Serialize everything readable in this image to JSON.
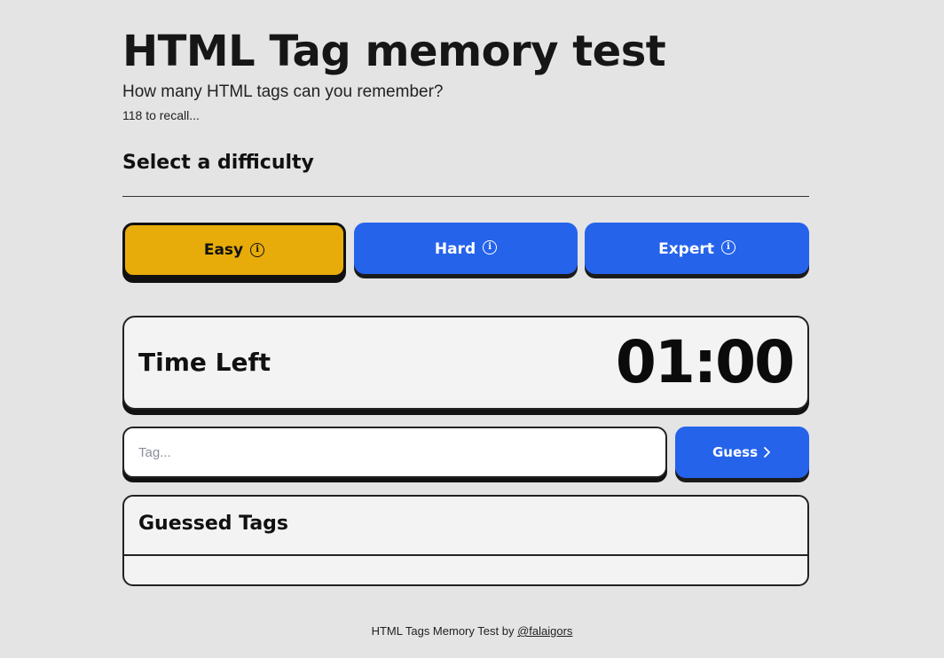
{
  "header": {
    "title": "HTML Tag memory test",
    "subtitle": "How many HTML tags can you remember?",
    "count_text": "118 to recall..."
  },
  "difficulty": {
    "heading": "Select a difficulty",
    "selected": "Easy",
    "options": [
      {
        "label": "Easy",
        "icon": "info-icon"
      },
      {
        "label": "Hard",
        "icon": "info-icon"
      },
      {
        "label": "Expert",
        "icon": "info-icon"
      }
    ]
  },
  "timer": {
    "label": "Time Left",
    "value": "01:00"
  },
  "guess": {
    "input_value": "",
    "placeholder": "Tag...",
    "button_label": "Guess",
    "button_icon": "chevron-right-icon"
  },
  "guessed": {
    "heading": "Guessed Tags",
    "items": []
  },
  "footer": {
    "text": "HTML Tags Memory Test by",
    "link_text": "@falaigors"
  },
  "colors": {
    "background": "#e4e4e4",
    "selected_difficulty": "#e8ac0a",
    "primary_button": "#2563eb",
    "card": "#f3f3f3",
    "border": "#222222"
  }
}
